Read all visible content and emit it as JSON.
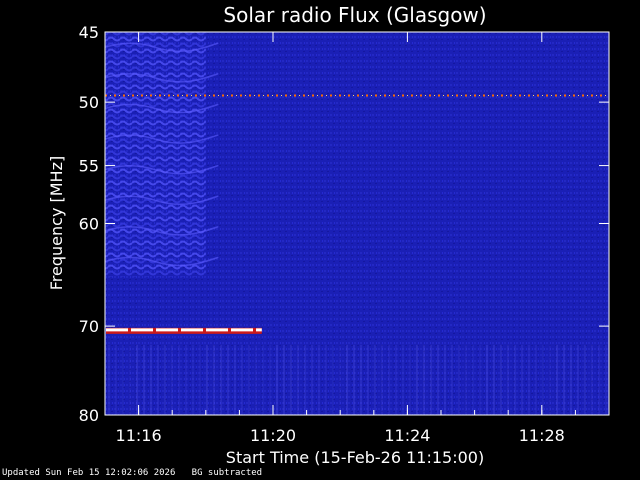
{
  "chart_data": {
    "type": "heatmap",
    "title": "Solar radio Flux (Glasgow)",
    "xlabel": "Start Time (15-Feb-26 11:15:00)",
    "ylabel": "Frequency [MHz]",
    "x_unit": "minutes",
    "xlim": [
      "11:15:00",
      "11:30:00"
    ],
    "ylim": [
      45,
      80
    ],
    "y_scale": "log",
    "y_ticks": [
      45,
      50,
      55,
      60,
      70,
      80
    ],
    "x_ticks": [
      "11:16",
      "11:20",
      "11:24",
      "11:28"
    ],
    "background_color": "#1b1fb8",
    "features": [
      {
        "name": "wave-pattern",
        "x_range": [
          "11:15:00",
          "11:18:00"
        ],
        "y_range": [
          45,
          65
        ],
        "color": "#5c5cff"
      },
      {
        "name": "interference-line",
        "x_range": [
          "11:15:00",
          "11:30:00"
        ],
        "y": 49.5,
        "color": "#ff6a00"
      },
      {
        "name": "strong-signal-band",
        "x_range": [
          "11:15:00",
          "11:19:40"
        ],
        "y": 70.5,
        "color": "#ffffff"
      }
    ]
  },
  "footer": {
    "text": "Updated Sun Feb 15 12:02:06 2026   BG subtracted"
  }
}
